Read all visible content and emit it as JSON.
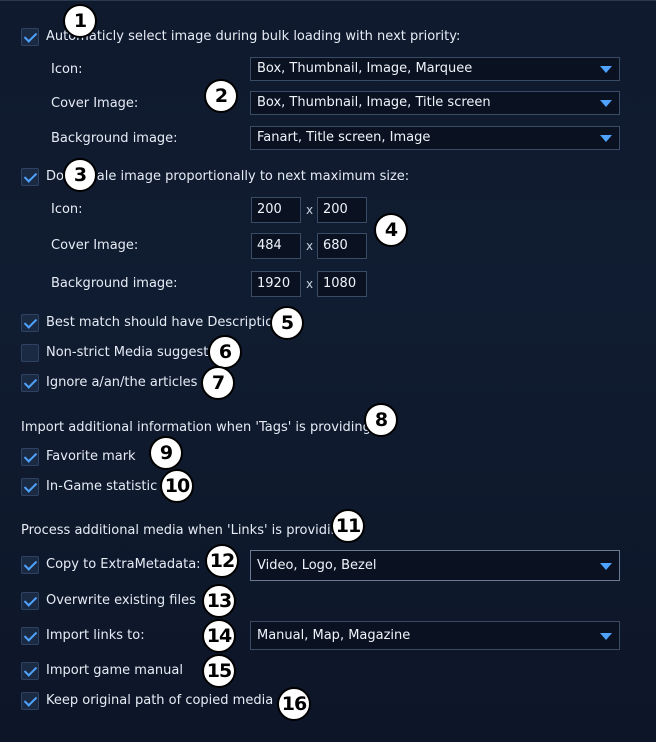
{
  "auto_select": {
    "checked": true,
    "label": "Automaticly select image during bulk loading with next priority:",
    "rows": [
      {
        "label": "Icon:",
        "value": "Box, Thumbnail, Image, Marquee"
      },
      {
        "label": "Cover Image:",
        "value": "Box, Thumbnail, Image, Title screen"
      },
      {
        "label": "Background image:",
        "value": "Fanart, Title screen, Image"
      }
    ]
  },
  "downscale": {
    "checked": true,
    "label": "Downscale image proportionally to next maximum size:",
    "separator": "x",
    "rows": [
      {
        "label": "Icon:",
        "width": "200",
        "height": "200"
      },
      {
        "label": "Cover Image:",
        "width": "484",
        "height": "680"
      },
      {
        "label": "Background image:",
        "width": "1920",
        "height": "1080"
      }
    ]
  },
  "options": {
    "best_match_description": {
      "checked": true,
      "label": "Best match should have Description"
    },
    "non_strict_media": {
      "checked": false,
      "label": "Non-strict Media suggest"
    },
    "ignore_articles": {
      "checked": true,
      "label": "Ignore a/an/the articles"
    }
  },
  "tags_section": {
    "heading": "Import additional information when 'Tags' is providing:",
    "favorite_mark": {
      "checked": true,
      "label": "Favorite mark"
    },
    "ingame_statistic": {
      "checked": true,
      "label": "In-Game statistic"
    }
  },
  "links_section": {
    "heading": "Process additional media when 'Links' is providing:",
    "copy_extrametadata": {
      "checked": true,
      "label": "Copy to ExtraMetadata:",
      "value": "Video, Logo, Bezel"
    },
    "overwrite_files": {
      "checked": true,
      "label": "Overwrite existing files"
    },
    "import_links": {
      "checked": true,
      "label": "Import links to:",
      "value": "Manual, Map, Magazine"
    },
    "import_manual": {
      "checked": true,
      "label": "Import game manual"
    },
    "keep_original_path": {
      "checked": true,
      "label": "Keep original path of copied media"
    }
  },
  "badges": [
    "1",
    "2",
    "3",
    "4",
    "5",
    "6",
    "7",
    "8",
    "9",
    "10",
    "11",
    "12",
    "13",
    "14",
    "15",
    "16"
  ],
  "colors": {
    "background": "#0f1a2e",
    "accent": "#4fa3ff",
    "text": "#e6ecf5",
    "badge": "#ffffff"
  }
}
